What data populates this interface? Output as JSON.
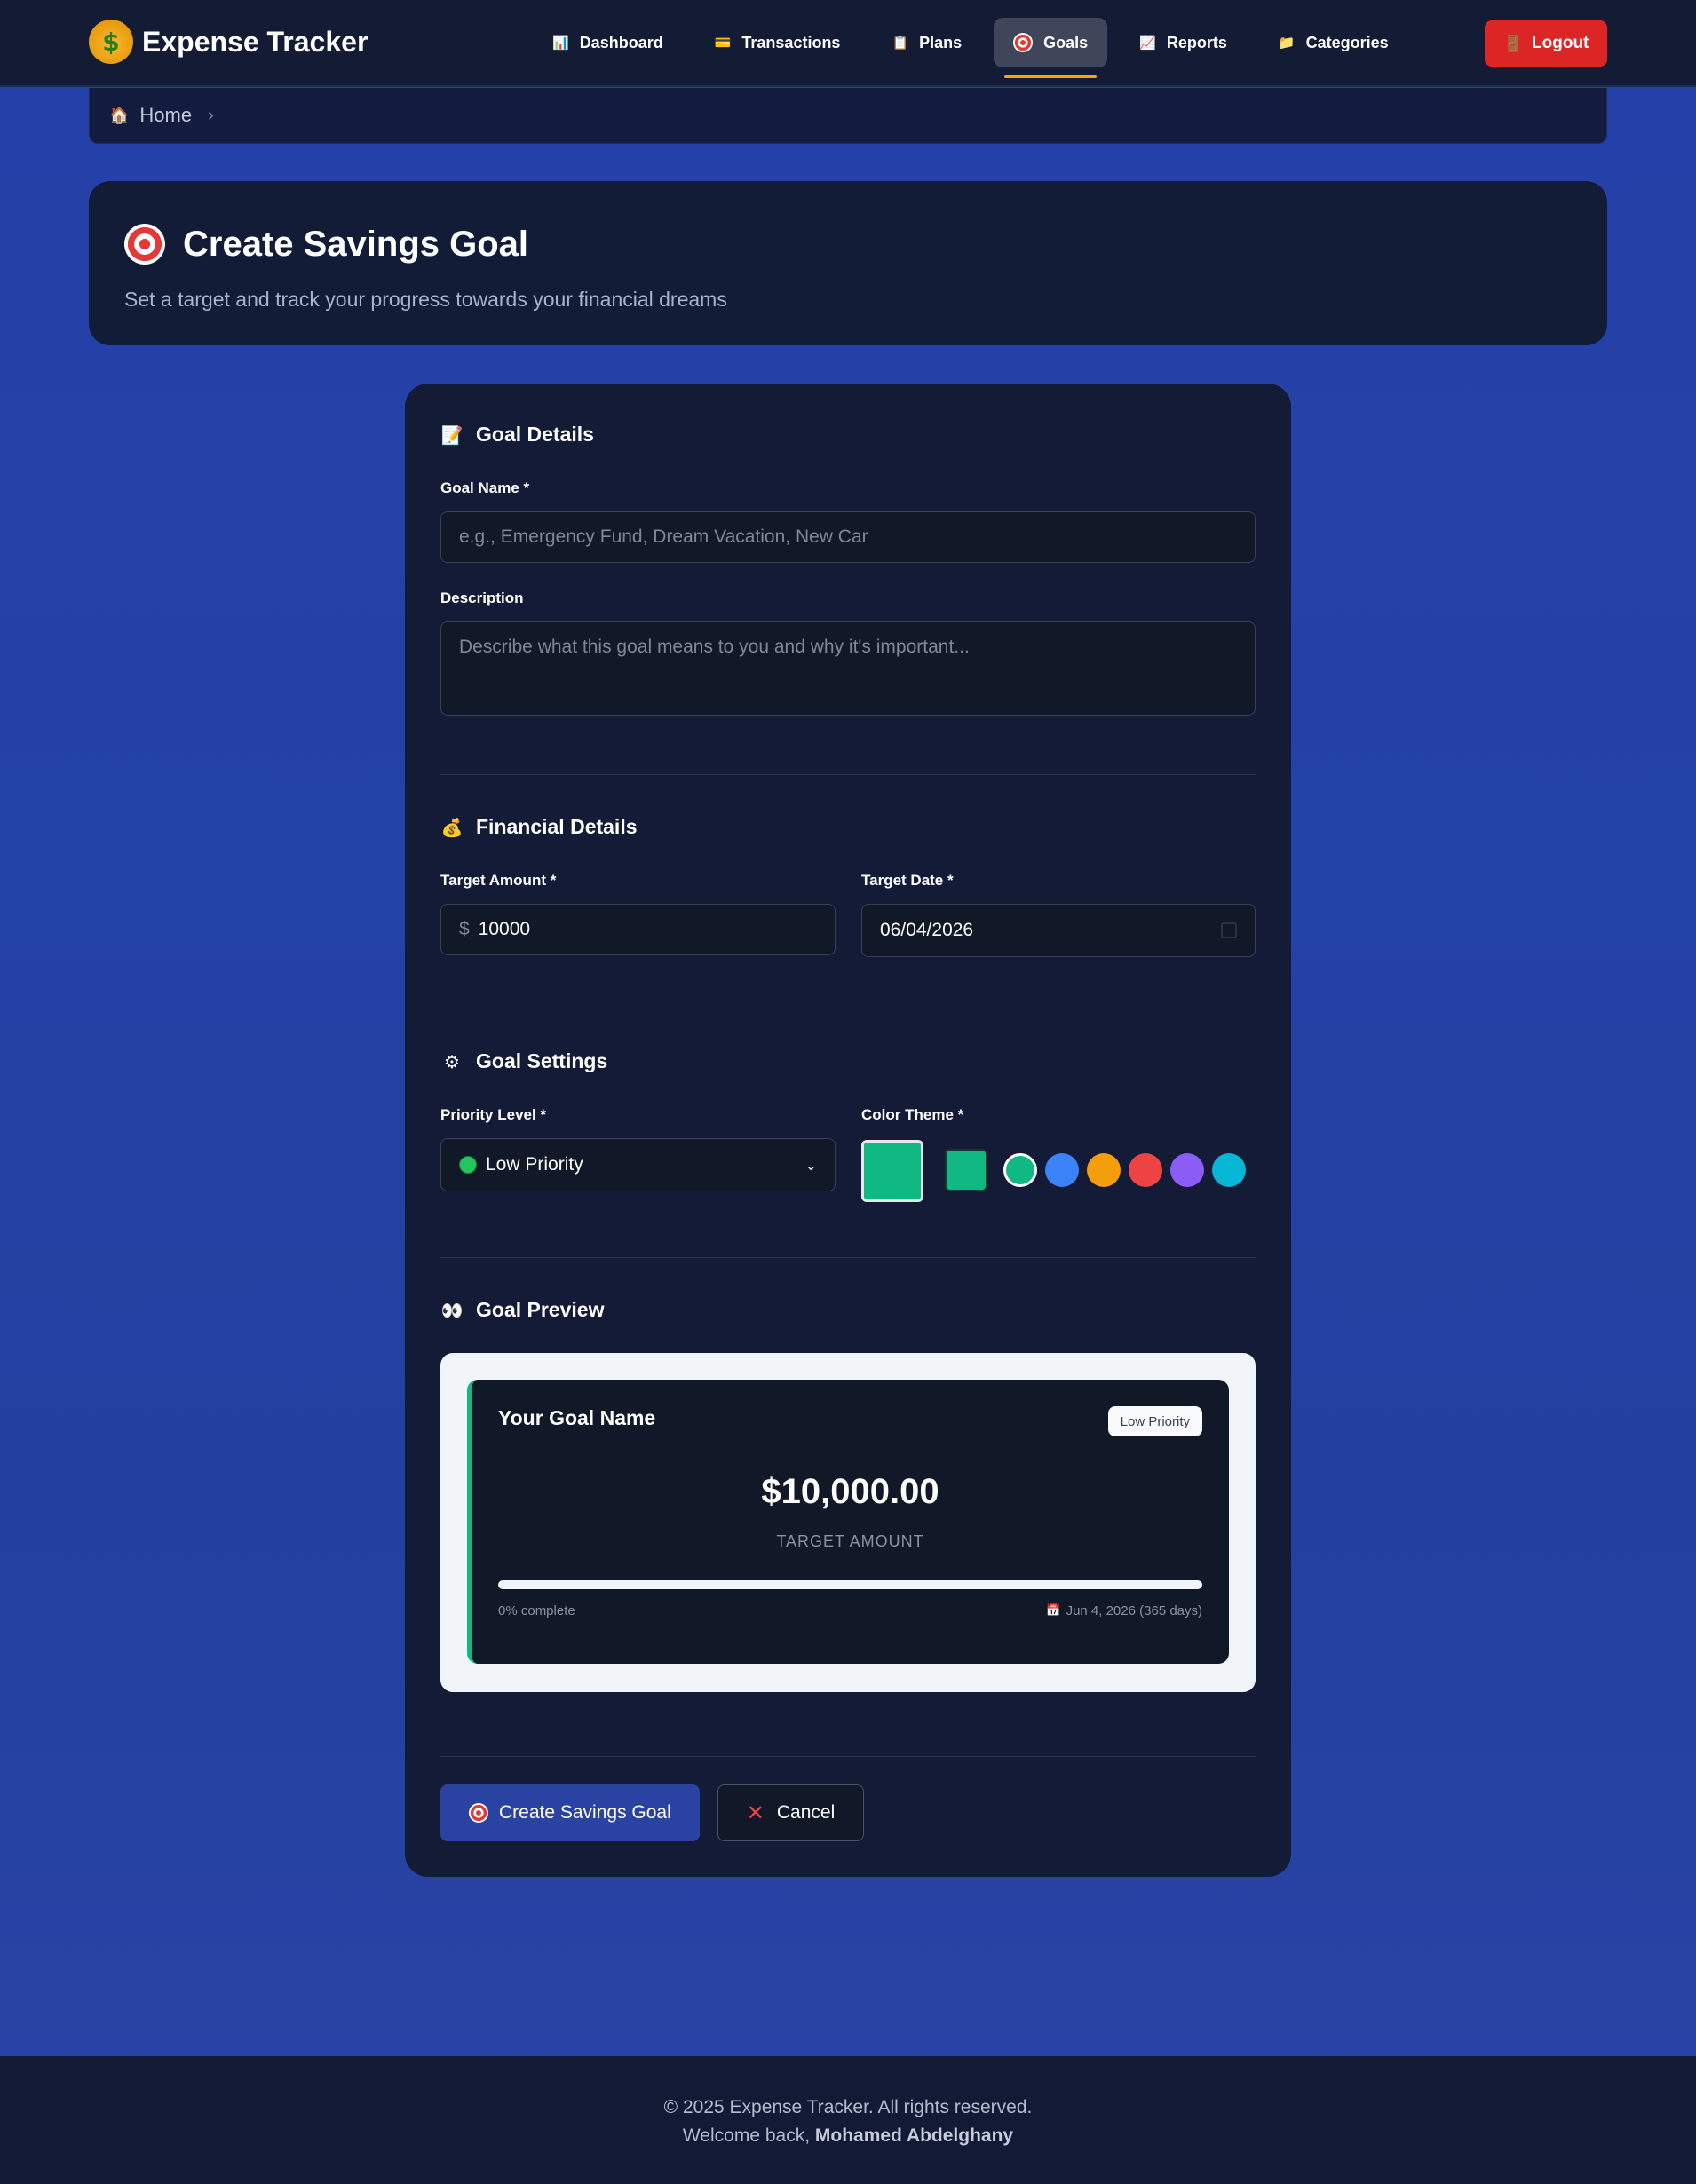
{
  "app": {
    "name": "Expense Tracker",
    "logo_icon": "money-bag-icon"
  },
  "nav": {
    "items": [
      {
        "label": "Dashboard",
        "icon": "bar-chart-icon",
        "active": false
      },
      {
        "label": "Transactions",
        "icon": "credit-card-icon",
        "active": false
      },
      {
        "label": "Plans",
        "icon": "clipboard-icon",
        "active": false
      },
      {
        "label": "Goals",
        "icon": "target-icon",
        "active": true
      },
      {
        "label": "Reports",
        "icon": "chart-up-icon",
        "active": false
      },
      {
        "label": "Categories",
        "icon": "folder-icon",
        "active": false
      }
    ],
    "logout_label": "Logout"
  },
  "breadcrumb": {
    "home_label": "Home"
  },
  "header": {
    "title": "Create Savings Goal",
    "subtitle": "Set a target and track your progress towards your financial dreams"
  },
  "form": {
    "goal_details": {
      "title": "Goal Details",
      "name_label": "Goal Name *",
      "name_placeholder": "e.g., Emergency Fund, Dream Vacation, New Car",
      "description_label": "Description",
      "description_placeholder": "Describe what this goal means to you and why it's important..."
    },
    "financial": {
      "title": "Financial Details",
      "amount_label": "Target Amount *",
      "currency_symbol": "$",
      "amount_value": "10000",
      "date_label": "Target Date *",
      "date_value": "06/04/2026"
    },
    "settings": {
      "title": "Goal Settings",
      "priority_label": "Priority Level *",
      "priority_value": "Low Priority",
      "color_label": "Color Theme *",
      "selected_color": "#10b981",
      "color_options": [
        "#10b981",
        "#3b82f6",
        "#f59e0b",
        "#ef4444",
        "#8b5cf6",
        "#06b6d4"
      ]
    },
    "preview": {
      "title": "Goal Preview",
      "goal_name": "Your Goal Name",
      "priority_badge": "Low Priority",
      "amount": "$10,000.00",
      "amount_label": "TARGET AMOUNT",
      "progress_fraction": 0,
      "progress_text": "0% complete",
      "date_text": "Jun 4, 2026 (365 days)"
    },
    "actions": {
      "submit_label": "Create Savings Goal",
      "cancel_label": "Cancel"
    }
  },
  "footer": {
    "copyright": "© 2025 Expense Tracker. All rights reserved.",
    "welcome_prefix": "Welcome back,",
    "user_name": "Mohamed Abdelghany"
  }
}
